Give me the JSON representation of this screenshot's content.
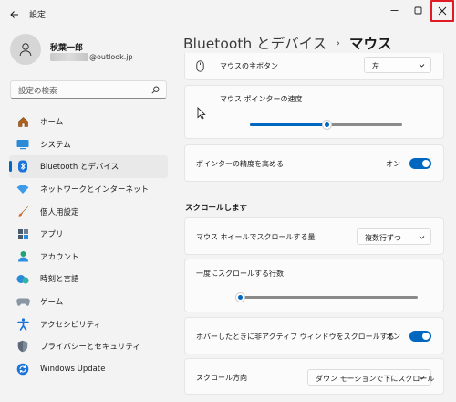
{
  "window": {
    "app_title": "設定"
  },
  "user": {
    "name": "秋葉一郎",
    "email_visible": "@outlook.jp"
  },
  "search": {
    "placeholder": "設定の検索"
  },
  "sidebar": {
    "items": [
      {
        "label": "ホーム",
        "icon": "home-icon",
        "active": false
      },
      {
        "label": "システム",
        "icon": "system-icon",
        "active": false
      },
      {
        "label": "Bluetooth とデバイス",
        "icon": "bluetooth-icon",
        "active": true
      },
      {
        "label": "ネットワークとインターネット",
        "icon": "network-icon",
        "active": false
      },
      {
        "label": "個人用設定",
        "icon": "brush-icon",
        "active": false
      },
      {
        "label": "アプリ",
        "icon": "apps-icon",
        "active": false
      },
      {
        "label": "アカウント",
        "icon": "account-icon",
        "active": false
      },
      {
        "label": "時刻と言語",
        "icon": "time-language-icon",
        "active": false
      },
      {
        "label": "ゲーム",
        "icon": "gamepad-icon",
        "active": false
      },
      {
        "label": "アクセシビリティ",
        "icon": "accessibility-icon",
        "active": false
      },
      {
        "label": "プライバシーとセキュリティ",
        "icon": "shield-icon",
        "active": false
      },
      {
        "label": "Windows Update",
        "icon": "update-icon",
        "active": false
      }
    ]
  },
  "breadcrumb": {
    "parent": "Bluetooth とデバイス",
    "separator": "›",
    "current": "マウス"
  },
  "settings": {
    "primary_button": {
      "label": "マウスの主ボタン",
      "value": "左"
    },
    "pointer_speed": {
      "label": "マウス ポインターの速度",
      "level": 0.5
    },
    "pointer_precision": {
      "label": "ポインターの精度を高める",
      "state": "オン",
      "on": true
    },
    "scroll_section_title": "スクロールします",
    "wheel_scroll": {
      "label": "マウス ホイールでスクロールする量",
      "value": "複数行ずつ"
    },
    "lines_to_scroll": {
      "label": "一度にスクロールする行数",
      "level": 0.0
    },
    "inactive_scroll": {
      "label": "ホバーしたときに非アクティブ ウィンドウをスクロールする",
      "state": "オン",
      "on": true
    },
    "scroll_direction": {
      "label": "スクロール方向",
      "value": "ダウン モーションで下にスクロール"
    }
  },
  "colors": {
    "accent": "#0067c0",
    "close_highlight": "#e01b24",
    "background": "#f3f3f3",
    "card": "#fbfbfb"
  }
}
